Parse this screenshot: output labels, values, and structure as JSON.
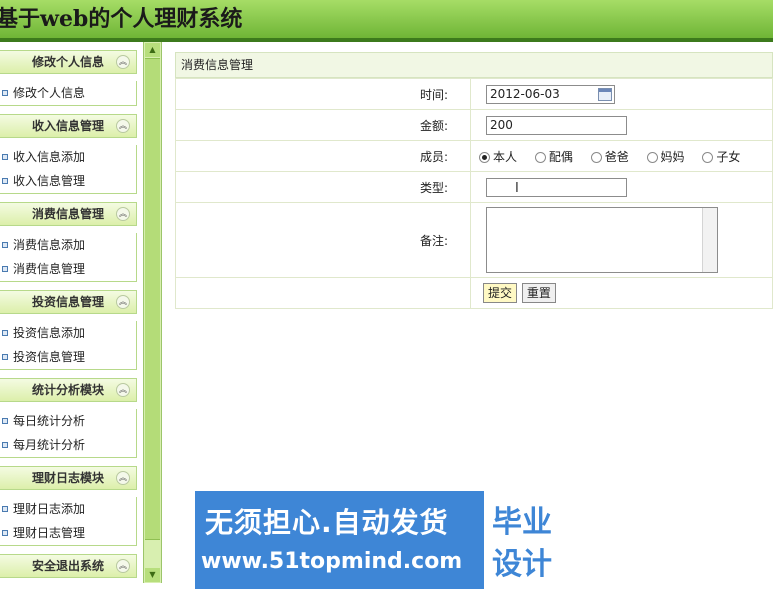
{
  "app": {
    "title": "基于web的个人理财系统"
  },
  "sidebar": {
    "sections": [
      {
        "title": "修改个人信息",
        "items": [
          "修改个人信息"
        ]
      },
      {
        "title": "收入信息管理",
        "items": [
          "收入信息添加",
          "收入信息管理"
        ]
      },
      {
        "title": "消费信息管理",
        "items": [
          "消费信息添加",
          "消费信息管理"
        ]
      },
      {
        "title": "投资信息管理",
        "items": [
          "投资信息添加",
          "投资信息管理"
        ]
      },
      {
        "title": "统计分析模块",
        "items": [
          "每日统计分析",
          "每月统计分析"
        ]
      },
      {
        "title": "理财日志模块",
        "items": [
          "理财日志添加",
          "理财日志管理"
        ]
      },
      {
        "title": "安全退出系统",
        "items": []
      }
    ],
    "collapse_icon": "double-chevron-up-icon"
  },
  "form": {
    "title": "消费信息管理",
    "fields": {
      "time": {
        "label": "时间:",
        "value": "2012-06-03"
      },
      "amount": {
        "label": "金额:",
        "value": "200"
      },
      "member": {
        "label": "成员:",
        "options": [
          "本人",
          "配偶",
          "爸爸",
          "妈妈",
          "子女"
        ],
        "selected": "本人"
      },
      "type": {
        "label": "类型:",
        "value": ""
      },
      "note": {
        "label": "备注:",
        "value": ""
      }
    },
    "buttons": {
      "submit": "提交",
      "reset": "重置"
    }
  },
  "watermark": {
    "line1": "无须担心.自动发货",
    "line2": "www.51topmind.com",
    "badge_line1": "毕业",
    "badge_line2": "设计"
  },
  "colors": {
    "header_green": "#6fb536",
    "accent_blue": "#3e86d6"
  }
}
